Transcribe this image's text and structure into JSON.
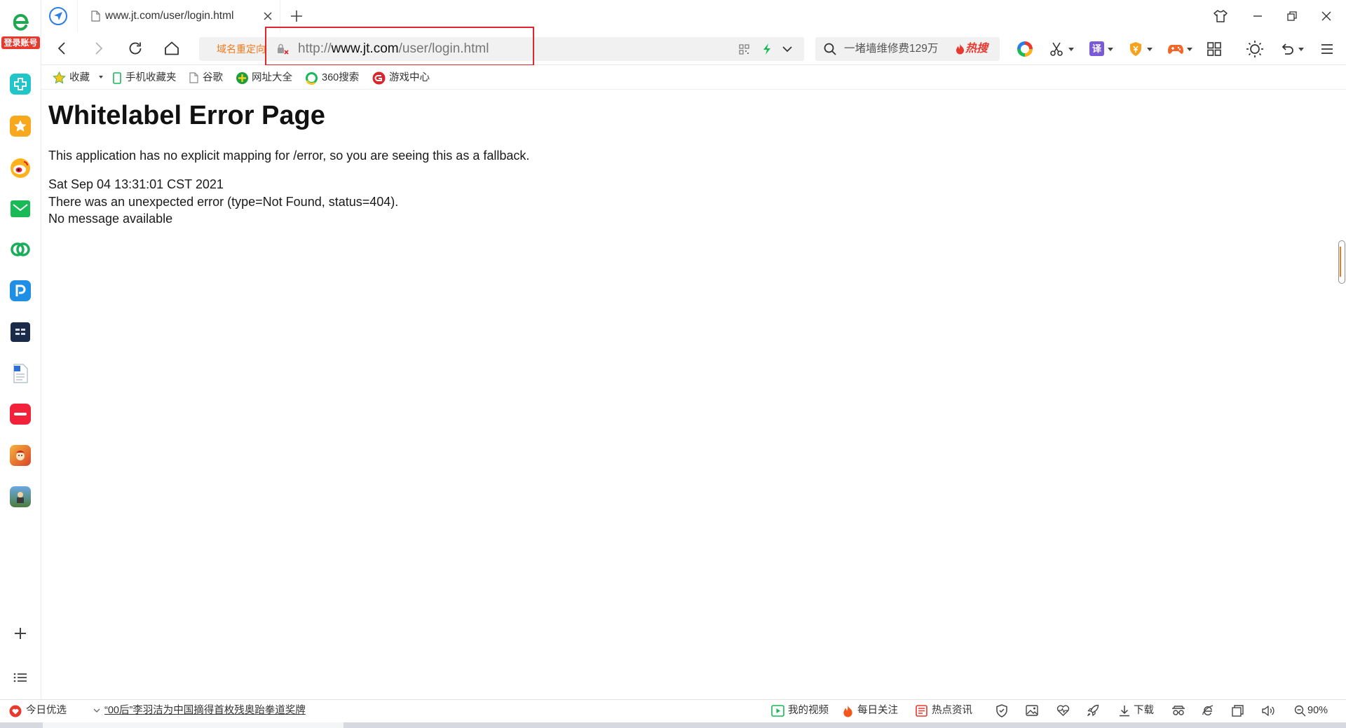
{
  "sidebar": {
    "login_badge": "登录账号"
  },
  "tab": {
    "title": "www.jt.com/user/login.html"
  },
  "address_bar": {
    "redirect_label": "域名重定向",
    "url_scheme": "http://",
    "url_host": "www.jt.com",
    "url_path": "/user/login.html"
  },
  "search": {
    "hot_query": "一堵墙维修费129万",
    "hot_label": "热搜"
  },
  "toolbar": {
    "translate_glyph": "译"
  },
  "bookmarks": [
    {
      "label": "收藏"
    },
    {
      "label": "手机收藏夹"
    },
    {
      "label": "谷歌"
    },
    {
      "label": "网址大全"
    },
    {
      "label": "360搜索"
    },
    {
      "label": "游戏中心"
    }
  ],
  "page": {
    "title": "Whitelabel Error Page",
    "description": "This application has no explicit mapping for /error, so you are seeing this as a fallback.",
    "timestamp": "Sat Sep 04 13:31:01 CST 2021",
    "error": "There was an unexpected error (type=Not Found, status=404).",
    "message": "No message available"
  },
  "status_bar": {
    "daily_picks": "今日优选",
    "news": "“00后”李羽洁为中国摘得首枚残奥跆拳道奖牌",
    "my_video": "我的视频",
    "daily_follow": "每日关注",
    "hot_news": "热点资讯",
    "download": "下载",
    "zoom": "90%"
  },
  "colors": {
    "accent_blue": "#2b7de9",
    "highlight_red": "#e0262b",
    "redirect_orange": "#f07a1d",
    "hot_red": "#e8392f",
    "field_bg": "#f1f1f1"
  },
  "icons": {
    "tabstrip": [
      "compass-icon",
      "page-icon",
      "close-icon",
      "plus-icon"
    ],
    "window": [
      "skin-icon",
      "minimize-icon",
      "restore-icon",
      "close-window-icon"
    ],
    "nav": [
      "back-icon",
      "forward-icon",
      "reload-icon",
      "home-icon",
      "insecure-lock-icon",
      "qr-code-icon",
      "lightning-icon",
      "chevron-down-icon"
    ],
    "toolbar": [
      "browser-ring-icon",
      "scissors-icon",
      "translate-icon",
      "shield-icon",
      "game-icon",
      "grid-icon",
      "brightness-icon",
      "undo-icon",
      "menu-icon"
    ],
    "sidebar": [
      "browser-logo-icon",
      "teal-app-icon",
      "star-icon",
      "weibo-icon",
      "mail-icon",
      "cloud-icon",
      "blue-p-app-icon",
      "navy-app-icon",
      "document-icon",
      "red-app-icon",
      "game-app-icon",
      "game-app-icon-2",
      "add-icon",
      "list-icon"
    ]
  }
}
